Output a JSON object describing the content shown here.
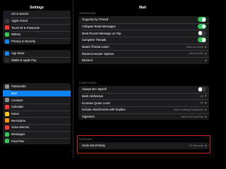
{
  "status": {
    "time": "08:26"
  },
  "sidebar": {
    "title": "Settings",
    "group1": [
      {
        "label": "Siri & Search",
        "color": "#1c1c2e",
        "icon": "siri-icon"
      },
      {
        "label": "Apple Pencil",
        "color": "#3a3a3c",
        "icon": "pencil-icon"
      },
      {
        "label": "Touch ID & Passcode",
        "color": "#ff3b30",
        "icon": "fingerprint-icon"
      },
      {
        "label": "Battery",
        "color": "#34c759",
        "icon": "battery-icon"
      },
      {
        "label": "Privacy & Security",
        "color": "#0a84ff",
        "icon": "hand-icon"
      }
    ],
    "group2": [
      {
        "label": "App Store",
        "color": "#0a84ff",
        "icon": "app-store-icon"
      },
      {
        "label": "Wallet & Apple Pay",
        "color": "#2c2c2e",
        "icon": "wallet-icon"
      }
    ],
    "group3": [
      {
        "label": "Passwords",
        "color": "#8e8e93",
        "icon": "key-icon"
      },
      {
        "label": "Mail",
        "color": "#0a84ff",
        "icon": "mail-icon",
        "active": true
      },
      {
        "label": "Contacts",
        "color": "#8e8e93",
        "icon": "contacts-icon"
      },
      {
        "label": "Calendar",
        "color": "#ff3b30",
        "icon": "calendar-icon"
      },
      {
        "label": "Notes",
        "color": "#ffcc00",
        "icon": "notes-icon"
      },
      {
        "label": "Reminders",
        "color": "#ff9500",
        "icon": "reminders-icon"
      },
      {
        "label": "Voice Memos",
        "color": "#ff3b30",
        "icon": "voice-memos-icon"
      },
      {
        "label": "Messages",
        "color": "#34c759",
        "icon": "messages-icon"
      },
      {
        "label": "FaceTime",
        "color": "#34c759",
        "icon": "facetime-icon"
      }
    ]
  },
  "main": {
    "title": "Mail",
    "threading": {
      "header": "THREADING",
      "rows": [
        {
          "label": "Organise by Thread",
          "toggle": true
        },
        {
          "label": "Collapse Read Messages",
          "toggle": true
        },
        {
          "label": "Most Recent Message on Top",
          "toggle": false
        },
        {
          "label": "Complete Threads",
          "toggle": true
        },
        {
          "label": "Muted Thread Action",
          "value": "Mark as Read"
        },
        {
          "label": "Blocked Sender Options",
          "value": "Move to Bin"
        },
        {
          "label": "Blocked",
          "value": ""
        }
      ]
    },
    "composing": {
      "header": "COMPOSING",
      "rows": [
        {
          "label": "Always Bcc Myself",
          "toggle": false
        },
        {
          "label": "Mark Addresses",
          "value": "Off"
        },
        {
          "label": "Increase Quote Level",
          "value": "On"
        },
        {
          "label": "Include Attachments with Replies",
          "value": "When Adding Recipients"
        },
        {
          "label": "Signature",
          "value": "Sent from my iPad"
        }
      ]
    },
    "sending": {
      "header": "SENDING",
      "rows": [
        {
          "label": "Undo Send Delay",
          "value": "10 Seconds"
        }
      ]
    }
  },
  "colors": {
    "accent": "#0a84ff",
    "toggle_on": "#34c759",
    "highlight": "#d1211a"
  }
}
